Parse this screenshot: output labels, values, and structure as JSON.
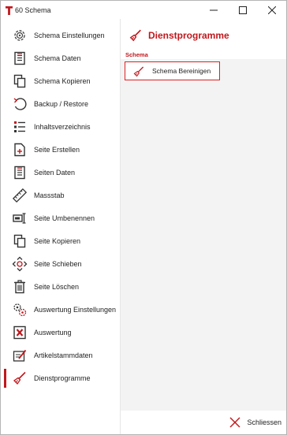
{
  "window": {
    "title": "60 Schema",
    "app_icon": "t-logo-icon",
    "controls": [
      "minimize-icon",
      "maximize-icon",
      "close-icon"
    ]
  },
  "sidebar": {
    "items": [
      {
        "label": "Schema Einstellungen",
        "icon": "gear-settings-icon"
      },
      {
        "label": "Schema Daten",
        "icon": "data-sheet-icon"
      },
      {
        "label": "Schema Kopieren",
        "icon": "copy-icon"
      },
      {
        "label": "Backup / Restore",
        "icon": "restore-icon"
      },
      {
        "label": "Inhaltsverzeichnis",
        "icon": "table-of-contents-icon"
      },
      {
        "label": "Seite Erstellen",
        "icon": "new-page-icon"
      },
      {
        "label": "Seiten Daten",
        "icon": "page-data-icon"
      },
      {
        "label": "Massstab",
        "icon": "ruler-icon"
      },
      {
        "label": "Seite Umbenennen",
        "icon": "rename-icon"
      },
      {
        "label": "Seite Kopieren",
        "icon": "copy-page-icon"
      },
      {
        "label": "Seite Schieben",
        "icon": "move-icon"
      },
      {
        "label": "Seite Löschen",
        "icon": "trash-icon"
      },
      {
        "label": "Auswertung Einstellungen",
        "icon": "evaluation-settings-icon"
      },
      {
        "label": "Auswertung",
        "icon": "excel-icon"
      },
      {
        "label": "Artikelstammdaten",
        "icon": "article-data-icon"
      },
      {
        "label": "Dienstprogramme",
        "icon": "broom-icon",
        "active": true
      }
    ]
  },
  "main": {
    "title": "Dienstprogramme",
    "section": "Schema",
    "action_label": "Schema Bereinigen"
  },
  "footer": {
    "close_label": "Schliessen"
  },
  "colors": {
    "accent": "#c0171c",
    "highlight_border": "#e02020",
    "panel_bg": "#f3f3f3"
  }
}
